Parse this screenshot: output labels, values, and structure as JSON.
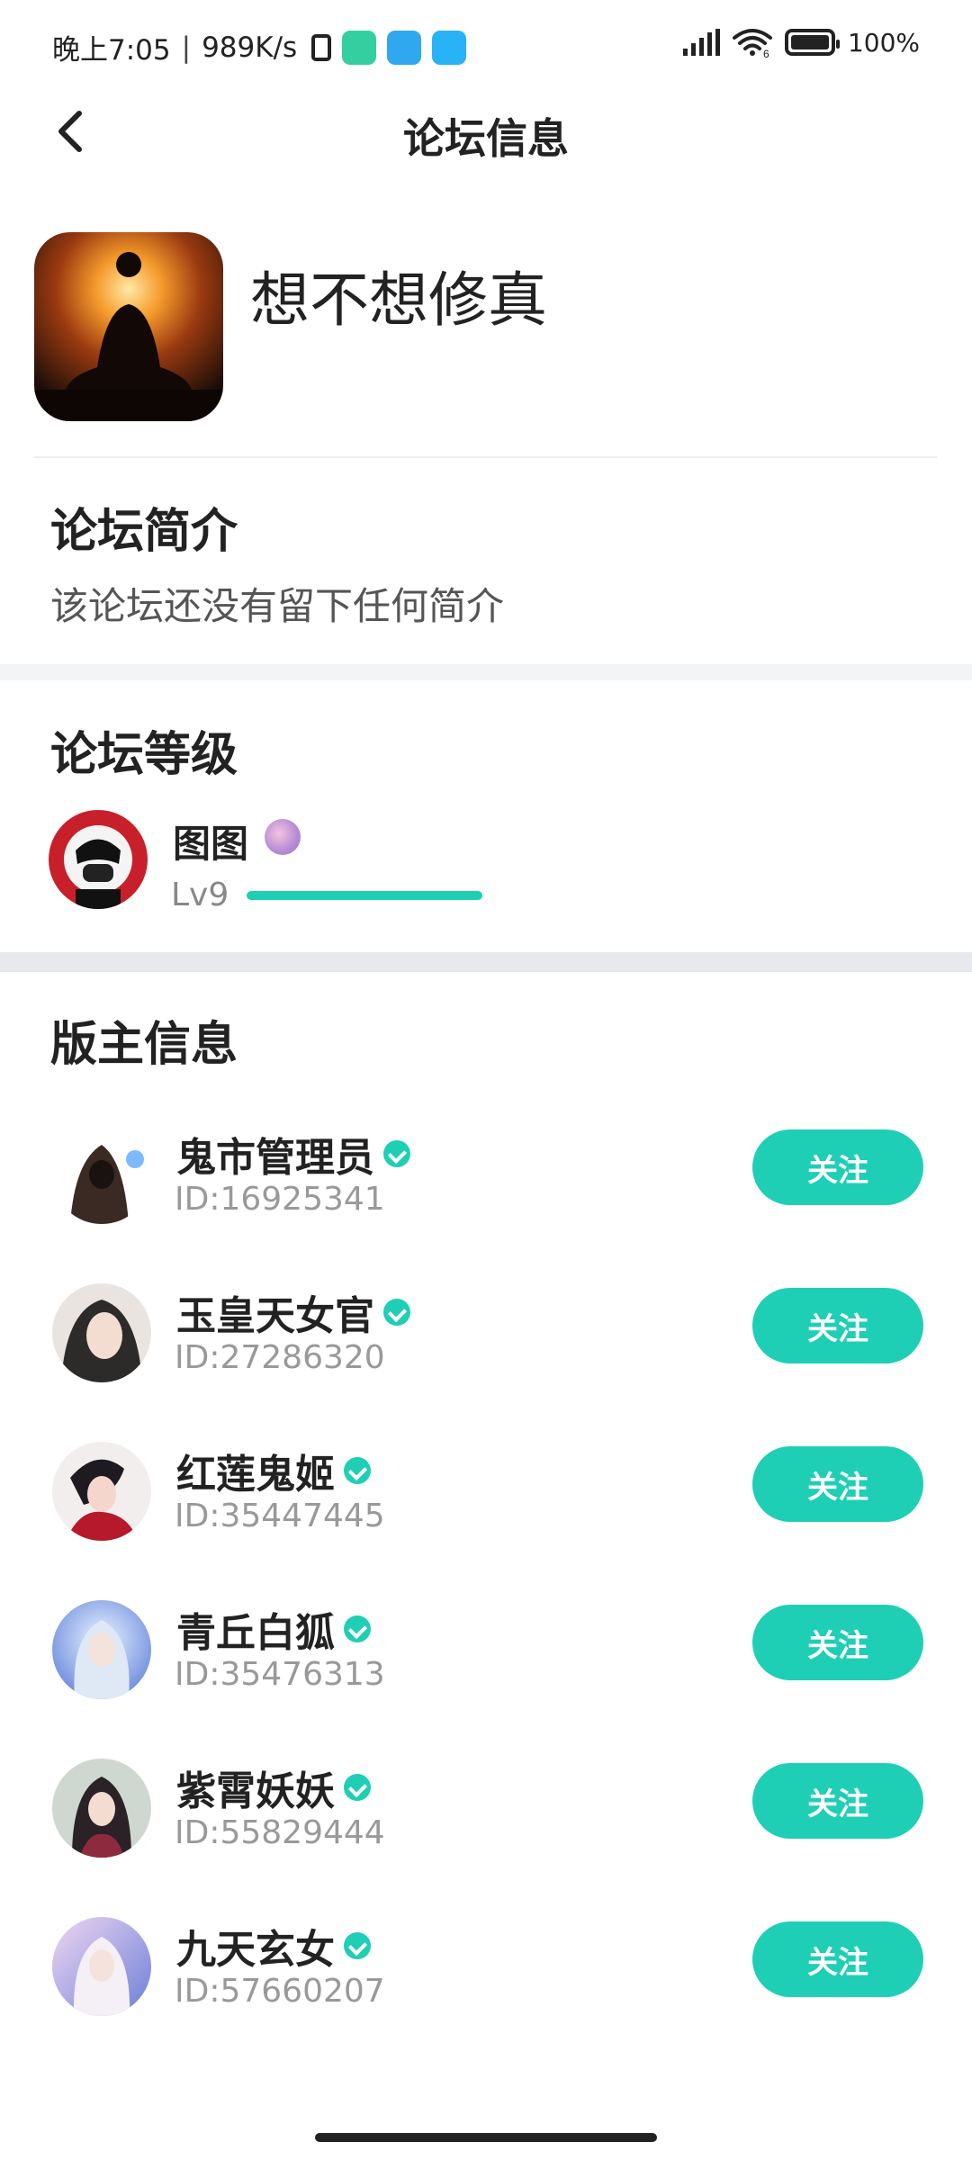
{
  "status_bar": {
    "time": "晚上7:05",
    "speed": "989K/s",
    "battery": "100%",
    "network_badge": "6"
  },
  "nav": {
    "title": "论坛信息"
  },
  "forum": {
    "name": "想不想修真"
  },
  "intro": {
    "title": "论坛简介",
    "text": "该论坛还没有留下任何简介"
  },
  "level": {
    "title": "论坛等级",
    "user_name": "图图",
    "level": "Lv9",
    "progress": 1.0
  },
  "moderators": {
    "title": "版主信息",
    "follow_label": "关注",
    "items": [
      {
        "name": "鬼市管理员",
        "id": "ID:16925341"
      },
      {
        "name": "玉皇天女官",
        "id": "ID:27286320"
      },
      {
        "name": "红莲鬼姬",
        "id": "ID:35447445"
      },
      {
        "name": "青丘白狐",
        "id": "ID:35476313"
      },
      {
        "name": "紫霄妖妖",
        "id": "ID:55829444"
      },
      {
        "name": "九天玄女",
        "id": "ID:57660207"
      }
    ]
  },
  "colors": {
    "accent": "#1ecfb5",
    "text": "#222222",
    "muted": "#999999",
    "band": "#f3f4f6"
  }
}
